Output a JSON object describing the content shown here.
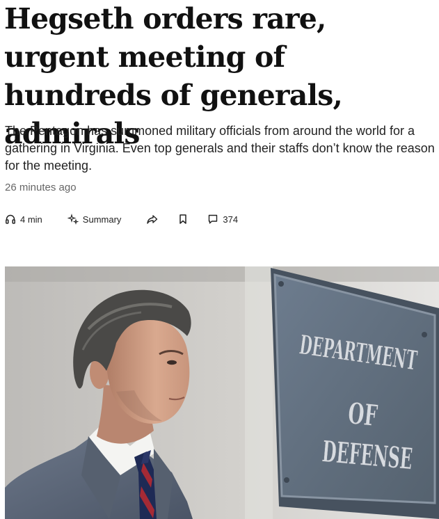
{
  "article": {
    "headline": "Hegseth orders rare, urgent meeting of hundreds of generals, admirals",
    "dek": "The Pentagon has summoned military officials from around the world for a gathering in Virginia. Even top generals and their staffs don’t know the reason for the meeting.",
    "timestamp": "26 minutes ago"
  },
  "toolbar": {
    "listen": {
      "icon": "headphones-icon",
      "label": "4 min"
    },
    "summary": {
      "icon": "sparkle-icon",
      "label": "Summary"
    },
    "share": {
      "icon": "share-arrow-icon"
    },
    "save": {
      "icon": "bookmark-icon"
    },
    "comments": {
      "icon": "comment-icon",
      "count": "374"
    }
  },
  "hero_image": {
    "plaque": {
      "line1": "DEPARTMENT",
      "line2": "OF",
      "line3": "DEFENSE"
    }
  },
  "colors": {
    "text": "#111111",
    "dek": "#222222",
    "muted": "#666666",
    "plaque": "#5f6e80",
    "suit": "#5a6577",
    "tie_navy": "#1e2a55",
    "tie_red": "#a52a35"
  }
}
